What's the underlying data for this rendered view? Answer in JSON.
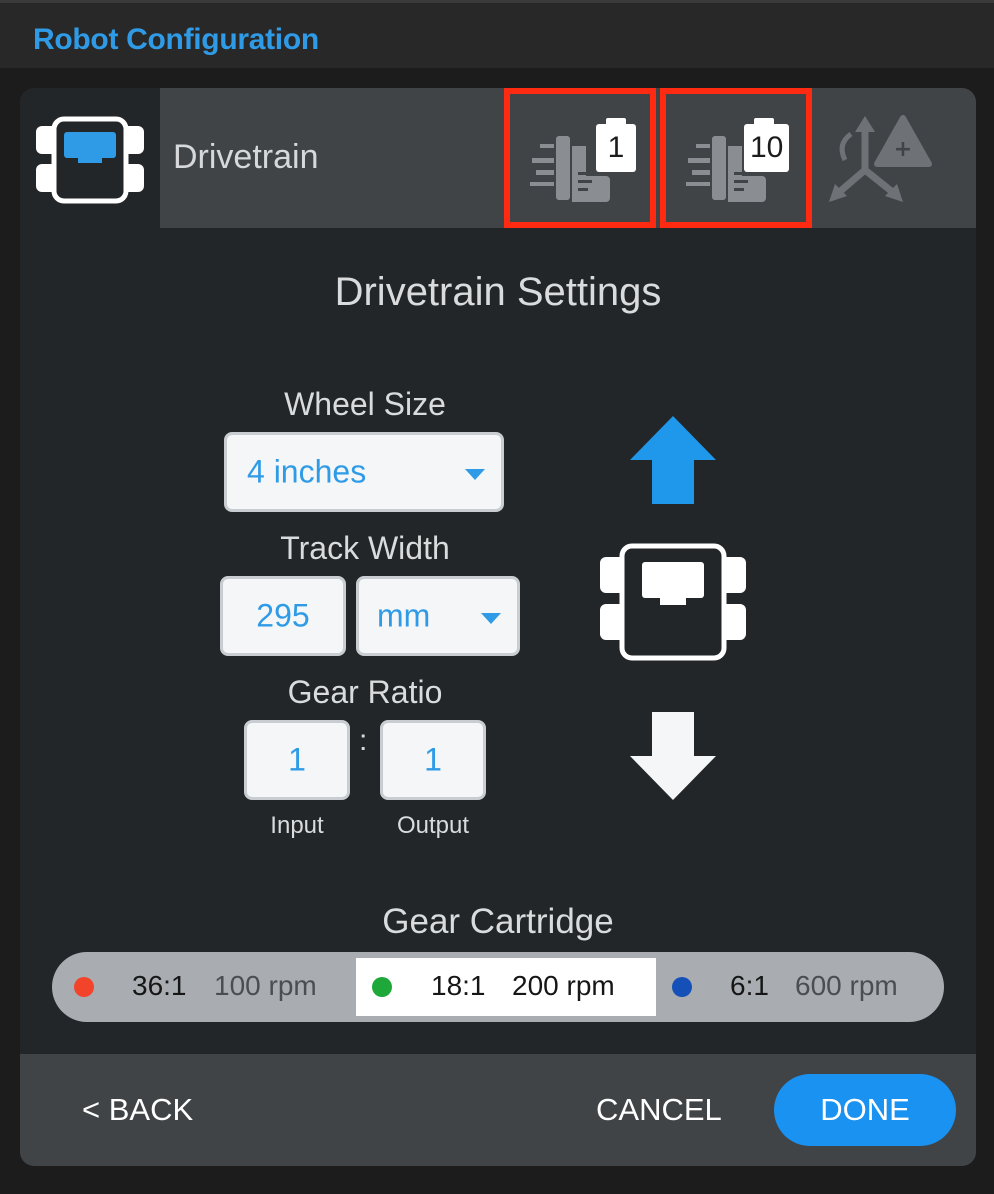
{
  "window": {
    "title": "Robot Configuration"
  },
  "header": {
    "device_name": "Drivetrain",
    "ports": [
      {
        "label": "1"
      },
      {
        "label": "10"
      }
    ],
    "device_icon": "drivetrain-icon",
    "add_sensor_icon": "add-gyro-sensor-icon"
  },
  "settings": {
    "title": "Drivetrain Settings",
    "wheel_size": {
      "label": "Wheel Size",
      "value": "4 inches"
    },
    "track_width": {
      "label": "Track Width",
      "value": "295",
      "unit": "mm"
    },
    "gear_ratio": {
      "label": "Gear Ratio",
      "separator": ":",
      "input_value": "1",
      "output_value": "1",
      "input_label": "Input",
      "output_label": "Output"
    }
  },
  "direction": {
    "forward_icon": "arrow-up-icon",
    "reverse_icon": "arrow-down-icon",
    "robot_icon": "drivetrain-icon"
  },
  "gear_cartridge": {
    "label": "Gear Cartridge",
    "options": [
      {
        "ratio": "36:1",
        "rpm": "100 rpm",
        "color": "#f2432b",
        "selected": false
      },
      {
        "ratio": "18:1",
        "rpm": "200 rpm",
        "color": "#1fa83a",
        "selected": true
      },
      {
        "ratio": "6:1",
        "rpm": "600 rpm",
        "color": "#1450b8",
        "selected": false
      }
    ]
  },
  "footer": {
    "back_label": "< BACK",
    "cancel_label": "CANCEL",
    "done_label": "DONE"
  },
  "colors": {
    "accent": "#2f9be6",
    "highlight": "#ff2a12",
    "done_button": "#1a92f2"
  }
}
